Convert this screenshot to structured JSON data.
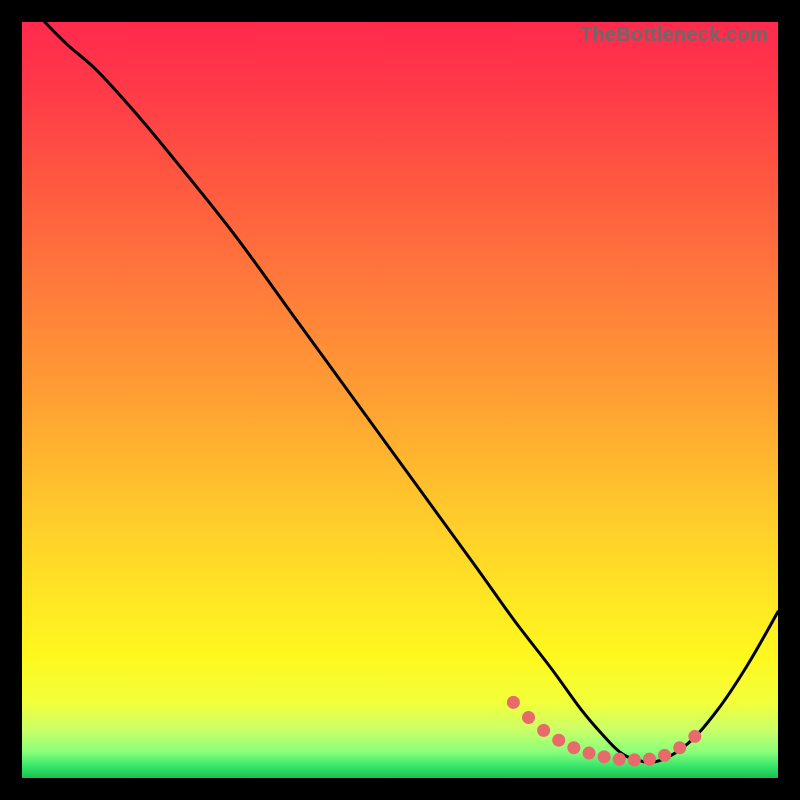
{
  "watermark": "TheBottleneck.com",
  "chart_data": {
    "type": "line",
    "title": "",
    "xlabel": "",
    "ylabel": "",
    "xlim": [
      0,
      100
    ],
    "ylim": [
      0,
      100
    ],
    "note": "Axes unlabeled; x read as 0-100% horizontal position, y as 0-100% where 100 is top. Curve shows a steep descent from upper-left to a trough near x≈80, then rises toward the right edge.",
    "series": [
      {
        "name": "curve",
        "x": [
          3,
          6,
          10,
          15,
          20,
          28,
          36,
          44,
          52,
          60,
          65,
          70,
          74,
          77,
          79,
          81,
          84,
          88,
          92,
          96,
          100
        ],
        "y": [
          100,
          97,
          93.5,
          88,
          82,
          72,
          61,
          50,
          39,
          28,
          21,
          14.5,
          9,
          5.5,
          3.5,
          2.5,
          2.2,
          4.5,
          9,
          15,
          22
        ]
      }
    ],
    "highlight_segment": {
      "name": "dotted-pink-zone",
      "x": [
        65,
        67,
        69,
        71,
        73,
        75,
        77,
        79,
        81,
        83,
        85,
        87,
        89
      ],
      "y": [
        10,
        8,
        6.3,
        5,
        4,
        3.3,
        2.8,
        2.5,
        2.4,
        2.5,
        3,
        4,
        5.5
      ]
    },
    "gradient_stops": [
      {
        "offset": 0.0,
        "color": "#ff2a4d"
      },
      {
        "offset": 0.09,
        "color": "#ff3a48"
      },
      {
        "offset": 0.22,
        "color": "#ff5a40"
      },
      {
        "offset": 0.36,
        "color": "#ff7d3a"
      },
      {
        "offset": 0.5,
        "color": "#ffa033"
      },
      {
        "offset": 0.63,
        "color": "#ffc52c"
      },
      {
        "offset": 0.75,
        "color": "#ffe325"
      },
      {
        "offset": 0.84,
        "color": "#fff81f"
      },
      {
        "offset": 0.9,
        "color": "#f2ff3a"
      },
      {
        "offset": 0.935,
        "color": "#ccff66"
      },
      {
        "offset": 0.965,
        "color": "#8bff7a"
      },
      {
        "offset": 0.985,
        "color": "#35e56a"
      },
      {
        "offset": 1.0,
        "color": "#17c24f"
      }
    ],
    "dot_color": "#e86a6a",
    "curve_color": "#000000"
  }
}
